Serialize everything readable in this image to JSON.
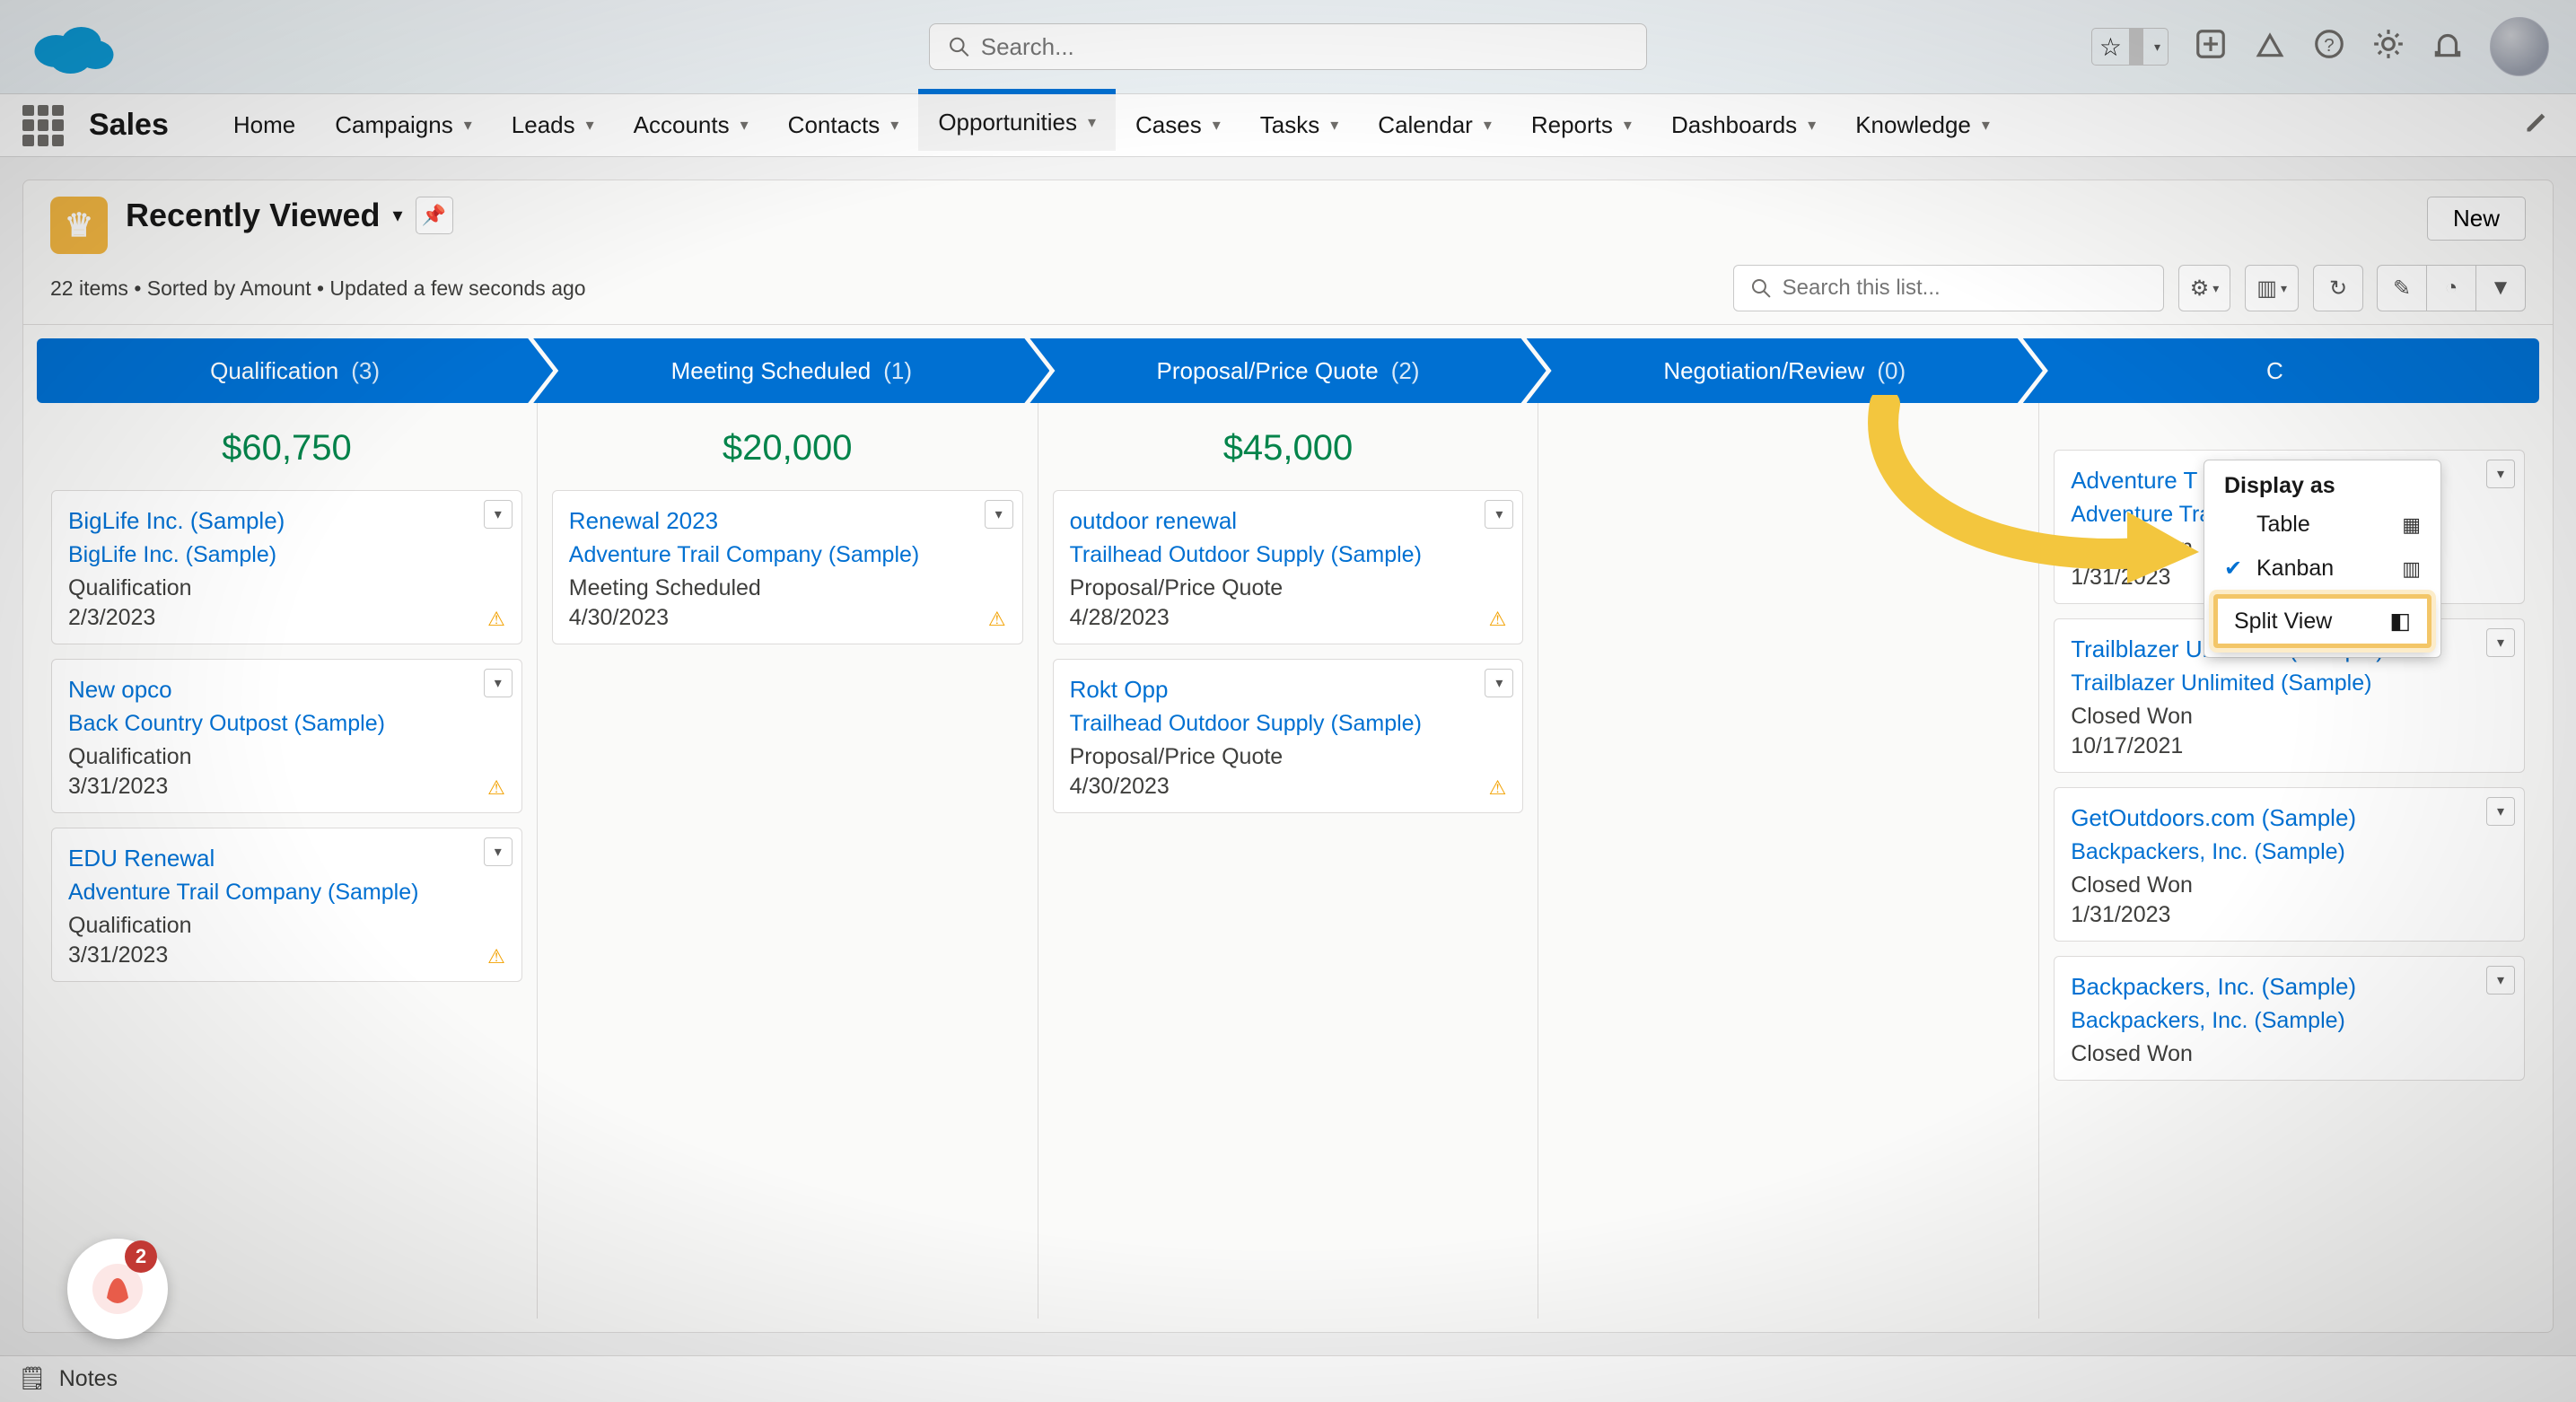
{
  "header": {
    "search_placeholder": "Search..."
  },
  "nav": {
    "app_name": "Sales",
    "tabs": [
      "Home",
      "Campaigns",
      "Leads",
      "Accounts",
      "Contacts",
      "Opportunities",
      "Cases",
      "Tasks",
      "Calendar",
      "Reports",
      "Dashboards",
      "Knowledge"
    ],
    "active_tab": "Opportunities"
  },
  "list": {
    "title": "Recently Viewed",
    "meta": "22 items • Sorted by Amount • Updated a few seconds ago",
    "new_button": "New",
    "search_placeholder": "Search this list..."
  },
  "popover": {
    "heading": "Display as",
    "items": [
      {
        "label": "Table",
        "checked": false,
        "icon": "▦"
      },
      {
        "label": "Kanban",
        "checked": true,
        "icon": "▥"
      },
      {
        "label": "Split View",
        "checked": false,
        "icon": "◧",
        "highlighted": true
      }
    ]
  },
  "stages": [
    {
      "name": "Qualification",
      "count": "(3)",
      "total": "$60,750"
    },
    {
      "name": "Meeting Scheduled",
      "count": "(1)",
      "total": "$20,000"
    },
    {
      "name": "Proposal/Price Quote",
      "count": "(2)",
      "total": "$45,000"
    },
    {
      "name": "Negotiation/Review",
      "count": "(0)",
      "total": ""
    },
    {
      "name": "C",
      "count": "",
      "total": ""
    }
  ],
  "columns": [
    {
      "total": "$60,750",
      "cards": [
        {
          "title": "BigLife Inc. (Sample)",
          "acct": "BigLife Inc. (Sample)",
          "stage": "Qualification",
          "date": "2/3/2023",
          "warn": true
        },
        {
          "title": "New opco",
          "acct": "Back Country Outpost (Sample)",
          "stage": "Qualification",
          "date": "3/31/2023",
          "warn": true
        },
        {
          "title": "EDU Renewal",
          "acct": "Adventure Trail Company (Sample)",
          "stage": "Qualification",
          "date": "3/31/2023",
          "warn": true
        }
      ]
    },
    {
      "total": "$20,000",
      "cards": [
        {
          "title": "Renewal 2023",
          "acct": "Adventure Trail Company (Sample)",
          "stage": "Meeting Scheduled",
          "date": "4/30/2023",
          "warn": true
        }
      ]
    },
    {
      "total": "$45,000",
      "cards": [
        {
          "title": "outdoor renewal",
          "acct": "Trailhead Outdoor Supply (Sample)",
          "stage": "Proposal/Price Quote",
          "date": "4/28/2023",
          "warn": true
        },
        {
          "title": "Rokt Opp",
          "acct": "Trailhead Outdoor Supply (Sample)",
          "stage": "Proposal/Price Quote",
          "date": "4/30/2023",
          "warn": true
        }
      ]
    },
    {
      "total": "",
      "cards": []
    },
    {
      "total": "",
      "cards": [
        {
          "title": "Adventure T",
          "acct": "Adventure Trail Company (Sample)",
          "stage": "Closed Won",
          "date": "1/31/2023",
          "warn": false
        },
        {
          "title": "Trailblazer Unlimited (Sample)",
          "acct": "Trailblazer Unlimited (Sample)",
          "stage": "Closed Won",
          "date": "10/17/2021",
          "warn": false
        },
        {
          "title": "GetOutdoors.com (Sample)",
          "acct": "Backpackers, Inc. (Sample)",
          "stage": "Closed Won",
          "date": "1/31/2023",
          "warn": false
        },
        {
          "title": "Backpackers, Inc. (Sample)",
          "acct": "Backpackers, Inc. (Sample)",
          "stage": "Closed Won",
          "date": "",
          "warn": false
        }
      ]
    }
  ],
  "footer": {
    "notes_label": "Notes"
  },
  "guru": {
    "count": "2"
  }
}
